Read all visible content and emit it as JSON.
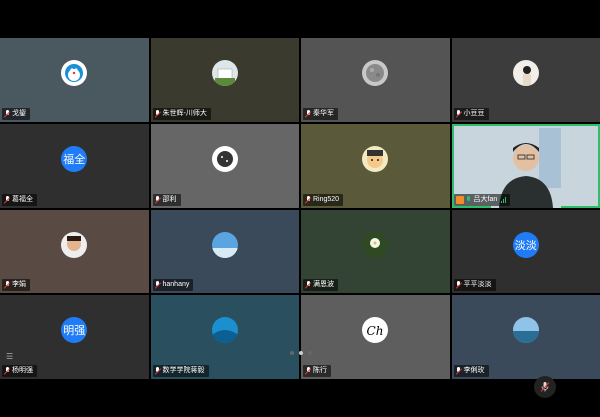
{
  "participants": [
    {
      "name": "戈鋆",
      "mic": "muted",
      "avatar": "doraemon",
      "bg": "#4a5860"
    },
    {
      "name": "朱世辉-川师大",
      "mic": "muted",
      "avatar": "building",
      "bg": "#3a3a2e"
    },
    {
      "name": "秦华军",
      "mic": "muted",
      "avatar": "stone",
      "bg": "#545454"
    },
    {
      "name": "小豆豆",
      "mic": "muted",
      "avatar": "girl",
      "bg": "#3c3c3c"
    },
    {
      "name": "葛福全",
      "mic": "muted",
      "avatar_text": "福全",
      "bg": "#2f2f2f"
    },
    {
      "name": "邵利",
      "mic": "muted",
      "avatar": "dark-circle",
      "bg": "#666"
    },
    {
      "name": "Ring520",
      "mic": "muted",
      "avatar": "cartoon-face",
      "bg": "#5a5a3a"
    },
    {
      "name": "吕大fan",
      "mic": "on",
      "host": true,
      "avatar": "video",
      "bg": "#c9d5dc",
      "active": true
    },
    {
      "name": "李娟",
      "mic": "muted",
      "avatar": "face",
      "bg": "#5a4a44"
    },
    {
      "name": "hanhany",
      "mic": "muted",
      "avatar": "sky",
      "bg": "#3a4a5a"
    },
    {
      "name": "满恩波",
      "mic": "muted",
      "avatar": "flower",
      "bg": "#344434"
    },
    {
      "name": "平平淡淡",
      "mic": "muted",
      "avatar_text": "淡淡",
      "bg": "#2f2f2f"
    },
    {
      "name": "杨明强",
      "mic": "muted",
      "avatar_text": "明强",
      "bg": "#2f2f2f"
    },
    {
      "name": "数学学院蒋毅",
      "mic": "muted",
      "avatar": "blue-wave",
      "bg": "#2a5060"
    },
    {
      "name": "陈行",
      "mic": "muted",
      "avatar": "ch-logo",
      "bg": "#5e5e5e"
    },
    {
      "name": "李俐玫",
      "mic": "muted",
      "avatar": "sea",
      "bg": "#3a4a5a"
    }
  ],
  "pagination": {
    "pages": 3,
    "current": 2
  },
  "colors": {
    "active_border": "#2dbe6c",
    "avatar_blue": "#1f7cf6"
  }
}
